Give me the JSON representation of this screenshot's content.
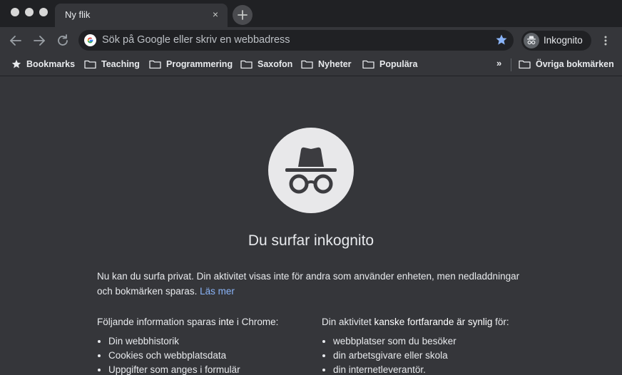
{
  "tab": {
    "title": "Ny flik",
    "close_glyph": "×",
    "new_tab_glyph": "+"
  },
  "toolbar": {
    "omnibox_placeholder": "Sök på Google eller skriv en webbadress",
    "profile_label": "Inkognito"
  },
  "bookmarks": {
    "items": [
      {
        "label": "Bookmarks",
        "icon": "star-icon"
      },
      {
        "label": "Teaching",
        "icon": "folder-icon"
      },
      {
        "label": "Programmering",
        "icon": "folder-icon"
      },
      {
        "label": "Saxofon",
        "icon": "folder-icon"
      },
      {
        "label": "Nyheter",
        "icon": "folder-icon"
      },
      {
        "label": "Populära",
        "icon": "folder-icon"
      }
    ],
    "overflow_glyph": "»",
    "other_label": "Övriga bokmärken"
  },
  "page": {
    "heading": "Du surfar inkognito",
    "intro": "Nu kan du surfa privat. Din aktivitet visas inte för andra som använder enheten, men nedladdningar och bokmärken sparas.",
    "learn_more": "Läs mer",
    "left": {
      "title_before": "Följande information sparas ",
      "title_bold": "inte",
      "title_after": " i Chrome:",
      "items": [
        "Din webbhistorik",
        "Cookies och webbplatsdata",
        "Uppgifter som anges i formulär"
      ]
    },
    "right": {
      "title_before": "Din aktivitet ",
      "title_bold": "kanske fortfarande är synlig",
      "title_after": " för:",
      "items": [
        "webbplatser som du besöker",
        "din arbetsgivare eller skola",
        "din internetleverantör."
      ]
    }
  },
  "colors": {
    "background": "#35363a",
    "tabstrip": "#202124",
    "text": "#e8eaed",
    "link": "#8ab4f8",
    "star_active": "#8ab4f8",
    "incognito_circle": "#e8e8ea",
    "incognito_glyph": "#3c3c40"
  }
}
